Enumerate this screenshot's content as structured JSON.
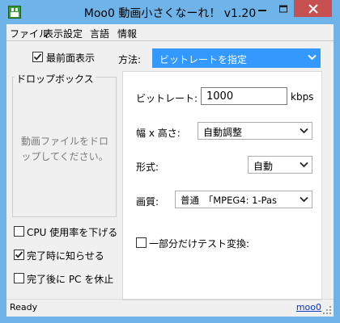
{
  "window": {
    "title": "Moo0 動画小さくなーれ！ v1.20",
    "accent_color": "#6fb4e8",
    "close_color": "#c75050"
  },
  "menu": {
    "items": [
      "ファイル",
      "表示設定",
      "言語",
      "情報"
    ]
  },
  "left": {
    "always_on_top": {
      "label": "最前面表示",
      "checked": true
    },
    "dropbox": {
      "title": "ドロップボックス",
      "text_line1": "動画ファイルをドロ",
      "text_line2": "ップしてください。"
    },
    "options": [
      {
        "label": "CPU 使用率を下げる",
        "checked": false
      },
      {
        "label": "完了時に知らせる",
        "checked": true
      },
      {
        "label": "完了後に PC を休止",
        "checked": false
      }
    ]
  },
  "method": {
    "label": "方法:",
    "value": "ビットレートを指定",
    "highlight_color": "#3399ff"
  },
  "settings": {
    "bitrate_label": "ビットレート:",
    "bitrate_value": "1000",
    "bitrate_unit": "kbps",
    "size_label": "幅 x 高さ:",
    "size_value": "自動調整",
    "format_label": "形式:",
    "format_value": "自動",
    "quality_label": "画質:",
    "quality_value": "普通　「MPEG4: 1-Pas",
    "partial_test_label": "一部分だけテスト変換:",
    "partial_test_checked": false
  },
  "status": {
    "text": "Ready",
    "link": "moo0"
  }
}
